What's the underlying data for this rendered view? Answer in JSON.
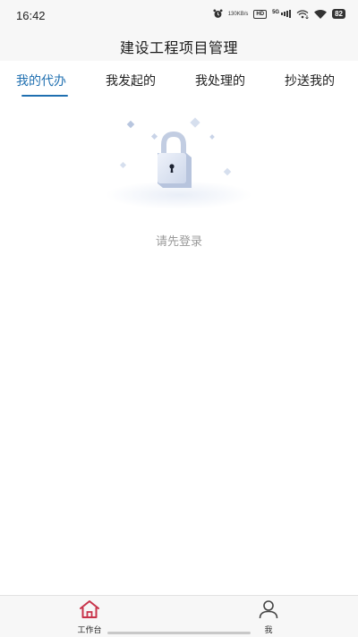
{
  "status_bar": {
    "time": "16:42",
    "net_speed_value": "130",
    "net_speed_unit": "KB/s",
    "hd_label": "HD",
    "signal_label": "5G",
    "battery": "82"
  },
  "header": {
    "title": "建设工程项目管理"
  },
  "tabs": [
    {
      "label": "我的代办",
      "active": true
    },
    {
      "label": "我发起的",
      "active": false
    },
    {
      "label": "我处理的",
      "active": false
    },
    {
      "label": "抄送我的",
      "active": false
    }
  ],
  "empty_state": {
    "icon": "lock-icon",
    "message": "请先登录"
  },
  "bottom_nav": [
    {
      "label": "工作台",
      "icon": "home-icon",
      "active": true
    },
    {
      "label": "我",
      "icon": "user-icon",
      "active": false
    }
  ],
  "colors": {
    "accent": "#1f6fb0",
    "home_active": "#c8334a",
    "muted_text": "#9a9a9a"
  }
}
